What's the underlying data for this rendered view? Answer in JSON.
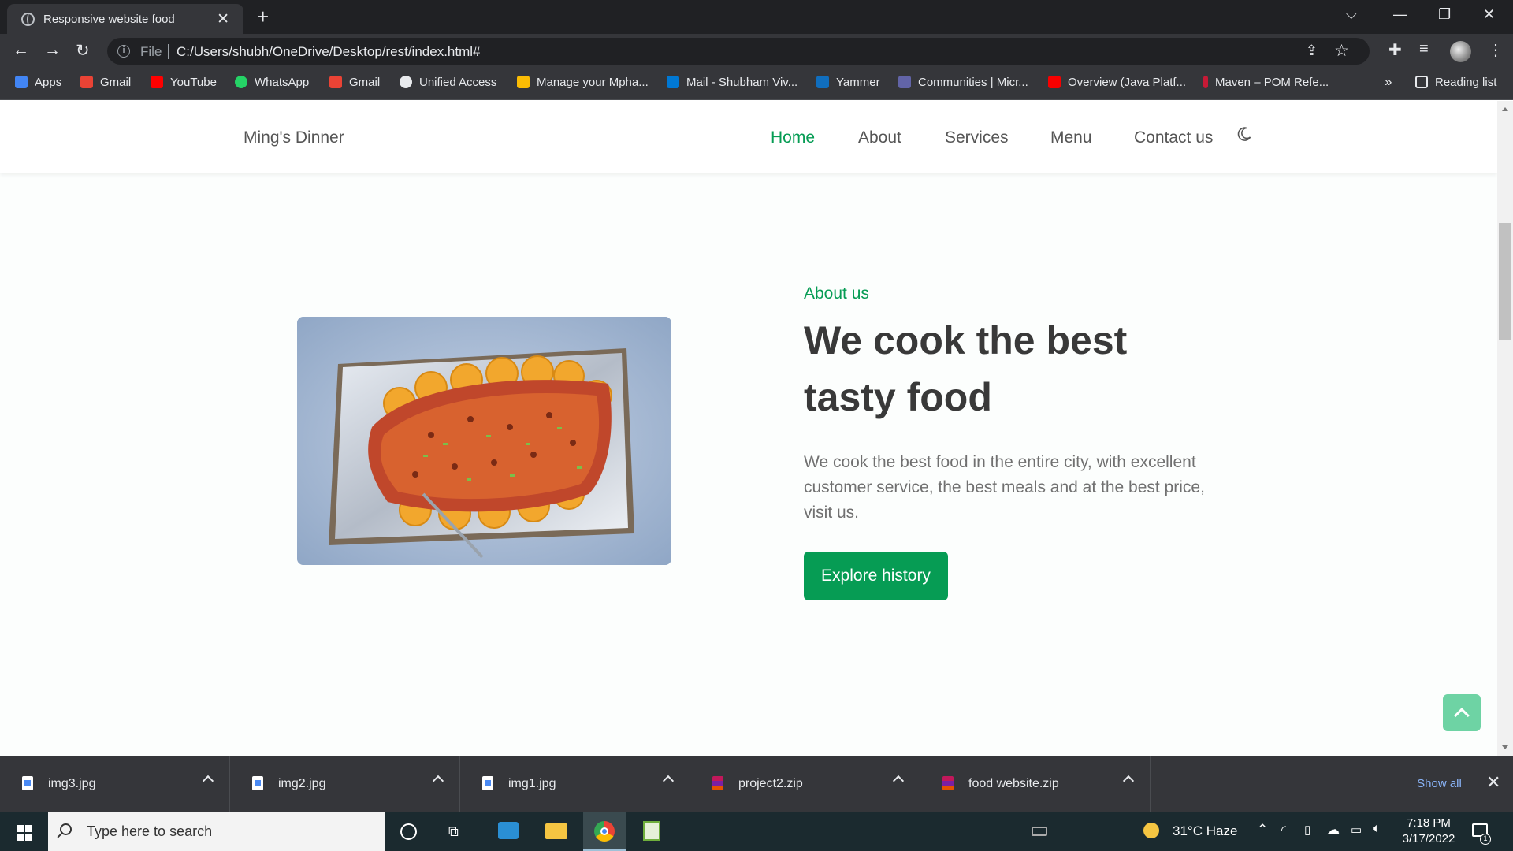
{
  "browser": {
    "tab_title": "Responsive website food",
    "new_tab_label": "+",
    "address_prefix": "File",
    "url": "C:/Users/shubh/OneDrive/Desktop/rest/index.html#",
    "bookmarks": [
      {
        "label": "Apps",
        "icon": "apps-grid-icon",
        "color": "#4285f4"
      },
      {
        "label": "Gmail",
        "icon": "gmail-icon",
        "color": "#ea4335"
      },
      {
        "label": "YouTube",
        "icon": "youtube-icon",
        "color": "#ff0000"
      },
      {
        "label": "WhatsApp",
        "icon": "whatsapp-icon",
        "color": "#25d366"
      },
      {
        "label": "Gmail",
        "icon": "gmail-icon",
        "color": "#ea4335"
      },
      {
        "label": "Unified Access",
        "icon": "globe-icon",
        "color": "#e8eaed"
      },
      {
        "label": "Manage your Mpha...",
        "icon": "chart-icon",
        "color": "#fbbc04"
      },
      {
        "label": "Mail - Shubham Viv...",
        "icon": "outlook-icon",
        "color": "#0078d4"
      },
      {
        "label": "Yammer",
        "icon": "yammer-icon",
        "color": "#106ebe"
      },
      {
        "label": "Communities | Micr...",
        "icon": "teams-icon",
        "color": "#6264a7"
      },
      {
        "label": "Overview (Java Platf...",
        "icon": "oracle-icon",
        "color": "#f80000"
      },
      {
        "label": "Maven – POM Refe...",
        "icon": "maven-icon",
        "color": "#c71a36"
      }
    ],
    "overflow_label": "»",
    "reading_list_label": "Reading list"
  },
  "site": {
    "logo": "Ming's Dinner",
    "nav": [
      {
        "label": "Home",
        "active": true
      },
      {
        "label": "About",
        "active": false
      },
      {
        "label": "Services",
        "active": false
      },
      {
        "label": "Menu",
        "active": false
      },
      {
        "label": "Contact us",
        "active": false
      }
    ],
    "theme_toggle_icon": "moon-icon",
    "about": {
      "subtitle": "About us",
      "headline": "We cook the best tasty food",
      "description": "We cook the best food in the entire city, with excellent customer service, the best meals and at the best price, visit us.",
      "button_label": "Explore history",
      "image_alt": "baked salmon on tray"
    },
    "accent_color": "#069c54"
  },
  "downloads": {
    "items": [
      {
        "name": "img3.jpg",
        "type": "image"
      },
      {
        "name": "img2.jpg",
        "type": "image"
      },
      {
        "name": "img1.jpg",
        "type": "image"
      },
      {
        "name": "project2.zip",
        "type": "zip"
      },
      {
        "name": "food website.zip",
        "type": "zip"
      }
    ],
    "show_all_label": "Show all"
  },
  "taskbar": {
    "search_placeholder": "Type here to search",
    "weather": "31°C  Haze",
    "time": "7:18 PM",
    "date": "3/17/2022",
    "notification_count": "1"
  }
}
